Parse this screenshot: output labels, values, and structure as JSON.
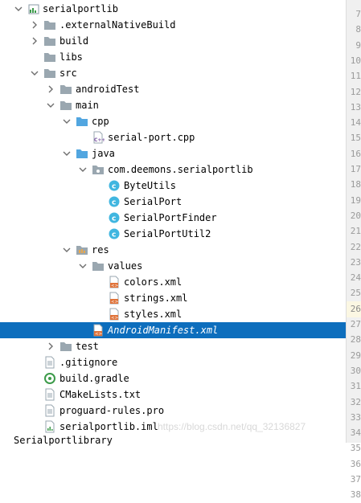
{
  "tree": [
    {
      "label": "serialportlib",
      "depth": 0,
      "arrow": "down",
      "icon": "module"
    },
    {
      "label": ".externalNativeBuild",
      "depth": 1,
      "arrow": "right",
      "icon": "folder-gray"
    },
    {
      "label": "build",
      "depth": 1,
      "arrow": "right",
      "icon": "folder-gray"
    },
    {
      "label": "libs",
      "depth": 1,
      "arrow": "none",
      "icon": "folder-gray"
    },
    {
      "label": "src",
      "depth": 1,
      "arrow": "down",
      "icon": "folder-gray"
    },
    {
      "label": "androidTest",
      "depth": 2,
      "arrow": "right",
      "icon": "folder-gray"
    },
    {
      "label": "main",
      "depth": 2,
      "arrow": "down",
      "icon": "folder-gray"
    },
    {
      "label": "cpp",
      "depth": 3,
      "arrow": "down",
      "icon": "folder-blue"
    },
    {
      "label": "serial-port.cpp",
      "depth": 4,
      "arrow": "none",
      "icon": "cpp-file"
    },
    {
      "label": "java",
      "depth": 3,
      "arrow": "down",
      "icon": "folder-blue"
    },
    {
      "label": "com.deemons.serialportlib",
      "depth": 4,
      "arrow": "down",
      "icon": "package"
    },
    {
      "label": "ByteUtils",
      "depth": 5,
      "arrow": "none",
      "icon": "class"
    },
    {
      "label": "SerialPort",
      "depth": 5,
      "arrow": "none",
      "icon": "class"
    },
    {
      "label": "SerialPortFinder",
      "depth": 5,
      "arrow": "none",
      "icon": "class"
    },
    {
      "label": "SerialPortUtil2",
      "depth": 5,
      "arrow": "none",
      "icon": "class"
    },
    {
      "label": "res",
      "depth": 3,
      "arrow": "down",
      "icon": "folder-res"
    },
    {
      "label": "values",
      "depth": 4,
      "arrow": "down",
      "icon": "folder-gray"
    },
    {
      "label": "colors.xml",
      "depth": 5,
      "arrow": "none",
      "icon": "xml-file"
    },
    {
      "label": "strings.xml",
      "depth": 5,
      "arrow": "none",
      "icon": "xml-file"
    },
    {
      "label": "styles.xml",
      "depth": 5,
      "arrow": "none",
      "icon": "xml-file"
    },
    {
      "label": "AndroidManifest.xml",
      "depth": 4,
      "arrow": "none",
      "icon": "manifest-file",
      "selected": true
    },
    {
      "label": "test",
      "depth": 2,
      "arrow": "right",
      "icon": "folder-gray"
    },
    {
      "label": ".gitignore",
      "depth": 1,
      "arrow": "none",
      "icon": "text-file"
    },
    {
      "label": "build.gradle",
      "depth": 1,
      "arrow": "none",
      "icon": "gradle-file"
    },
    {
      "label": "CMakeLists.txt",
      "depth": 1,
      "arrow": "none",
      "icon": "text-file"
    },
    {
      "label": "proguard-rules.pro",
      "depth": 1,
      "arrow": "none",
      "icon": "text-file"
    },
    {
      "label": "serialportlib.iml",
      "depth": 1,
      "arrow": "none",
      "icon": "iml-file"
    }
  ],
  "partial_row": "Serialportlibrary",
  "line_numbers": [
    "7",
    "8",
    "9",
    "10",
    "11",
    "12",
    "13",
    "14",
    "15",
    "16",
    "17",
    "18",
    "19",
    "20",
    "21",
    "22",
    "23",
    "24",
    "25",
    "26",
    "27",
    "28",
    "29",
    "30",
    "31",
    "32",
    "33",
    "34",
    "35",
    "36",
    "37",
    "38"
  ],
  "current_line": "26",
  "watermark": "https://blog.csdn.net/qq_32136827",
  "colors": {
    "selection": "#0d6ebd",
    "folder_blue": "#52a6e0",
    "folder_gray": "#9aa7b0",
    "class_circle": "#40b6e0",
    "xml_orange": "#e0733a"
  }
}
